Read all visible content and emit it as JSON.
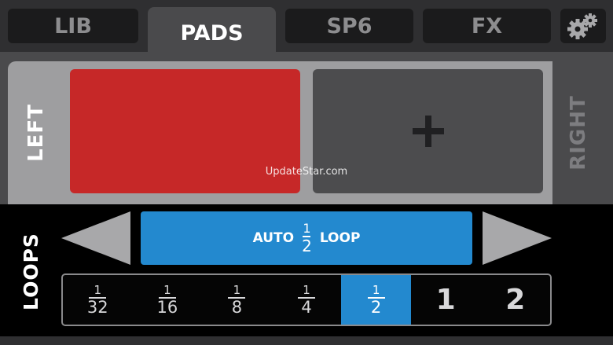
{
  "tabs": [
    {
      "label": "LIB"
    },
    {
      "label": "PADS"
    },
    {
      "label": "SP6"
    },
    {
      "label": "FX"
    }
  ],
  "active_tab": "PADS",
  "settings_icon": "gears-icon",
  "pads": {
    "left_label": "LEFT",
    "right_label": "RIGHT",
    "pad_1_color": "#c62828",
    "pad_2_icon": "plus-icon"
  },
  "watermark": "UpdateStar.com",
  "loops": {
    "label": "LOOPS",
    "auto_button": {
      "prefix": "AUTO",
      "fraction_num": "1",
      "fraction_den": "2",
      "suffix": "LOOP"
    },
    "sizes": [
      {
        "num": "1",
        "den": "32"
      },
      {
        "num": "1",
        "den": "16"
      },
      {
        "num": "1",
        "den": "8"
      },
      {
        "num": "1",
        "den": "4"
      },
      {
        "num": "1",
        "den": "2"
      },
      {
        "whole": "1"
      },
      {
        "whole": "2"
      }
    ],
    "selected_size": "1/2",
    "accent_color": "#2389cf"
  }
}
